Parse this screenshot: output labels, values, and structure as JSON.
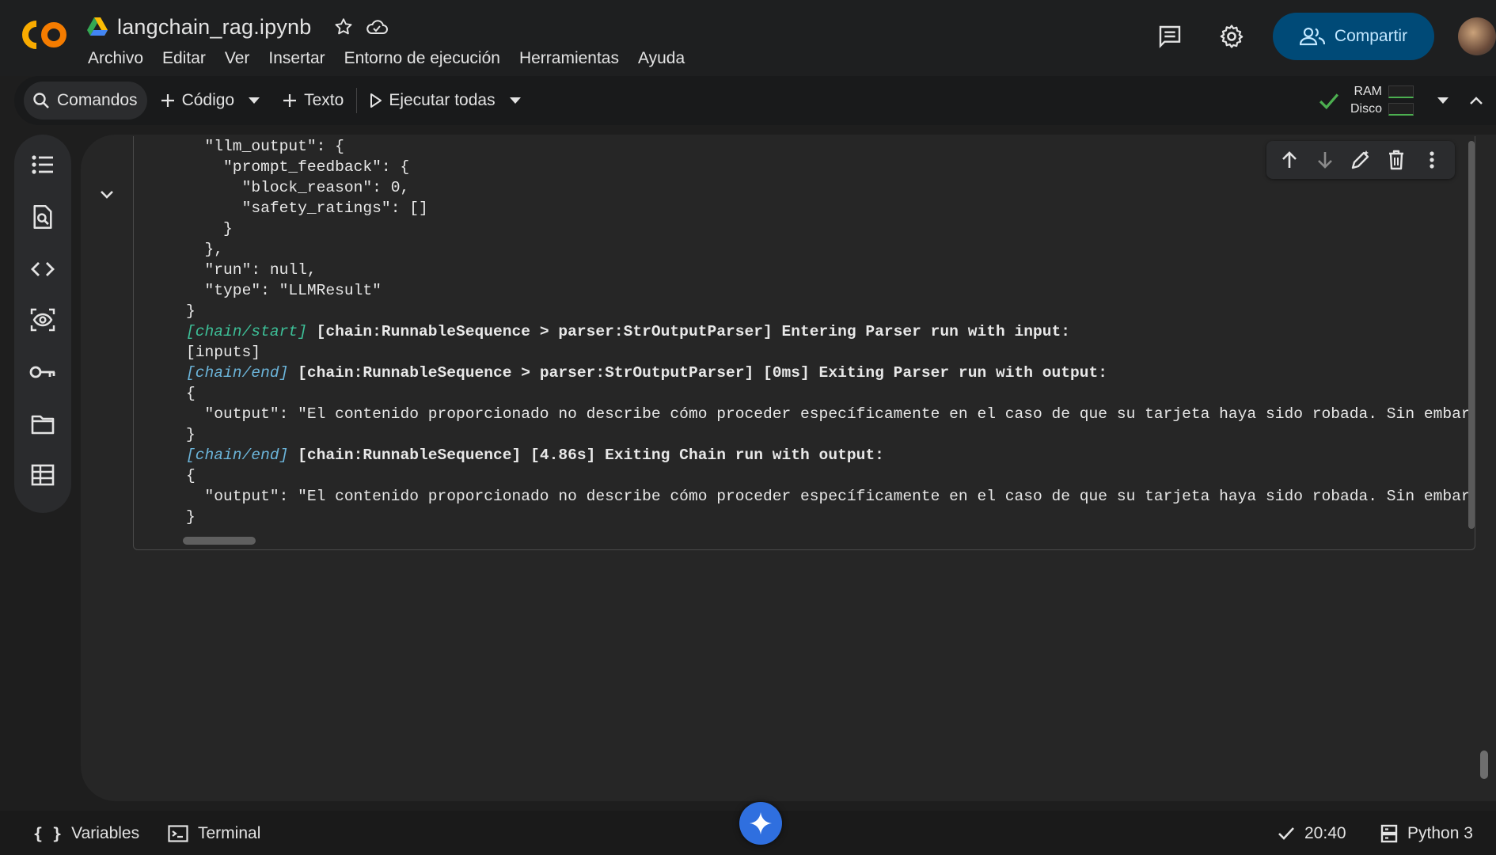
{
  "header": {
    "title": "langchain_rag.ipynb",
    "logo_text": "CO",
    "menu": [
      "Archivo",
      "Editar",
      "Ver",
      "Insertar",
      "Entorno de ejecución",
      "Herramientas",
      "Ayuda"
    ],
    "share_label": "Compartir"
  },
  "toolbar": {
    "commands_label": "Comandos",
    "code_label": "Código",
    "text_label": "Texto",
    "run_all_label": "Ejecutar todas",
    "ram_label": "RAM",
    "disk_label": "Disco"
  },
  "output": {
    "lines": [
      {
        "indent": "  ",
        "text": "\"llm_output\": {"
      },
      {
        "indent": "    ",
        "text": "\"prompt_feedback\": {"
      },
      {
        "indent": "      ",
        "text": "\"block_reason\": 0,"
      },
      {
        "indent": "      ",
        "text": "\"safety_ratings\": []"
      },
      {
        "indent": "    ",
        "text": "}"
      },
      {
        "indent": "  ",
        "text": "},"
      },
      {
        "indent": "  ",
        "text": "\"run\": null,"
      },
      {
        "indent": "  ",
        "text": "\"type\": \"LLMResult\""
      },
      {
        "indent": "",
        "text": "}"
      }
    ],
    "chain_start_tag": "[chain/start]",
    "chain_start_text": " [chain:RunnableSequence > parser:StrOutputParser] Entering Parser run with input:",
    "inputs_line": "[inputs]",
    "chain_end_tag_1": "[chain/end]",
    "chain_end_text_1": " [chain:RunnableSequence > parser:StrOutputParser] [0ms] Exiting Parser run with output:",
    "brace_open": "{",
    "brace_close": "}",
    "output_line": "  \"output\": \"El contenido proporcionado no describe cómo proceder específicamente en el caso de que su tarjeta haya sido robada. Sin embargo",
    "chain_end_tag_2": "[chain/end]",
    "chain_end_text_2": " [chain:RunnableSequence] [4.86s] Exiting Chain run with output:",
    "output_line_2": "  \"output\": \"El contenido proporcionado no describe cómo proceder específicamente en el caso de que su tarjeta haya sido robada. Sin embargo"
  },
  "bottom": {
    "variables_label": "Variables",
    "terminal_label": "Terminal",
    "time_label": "20:40",
    "runtime_label": "Python 3"
  }
}
